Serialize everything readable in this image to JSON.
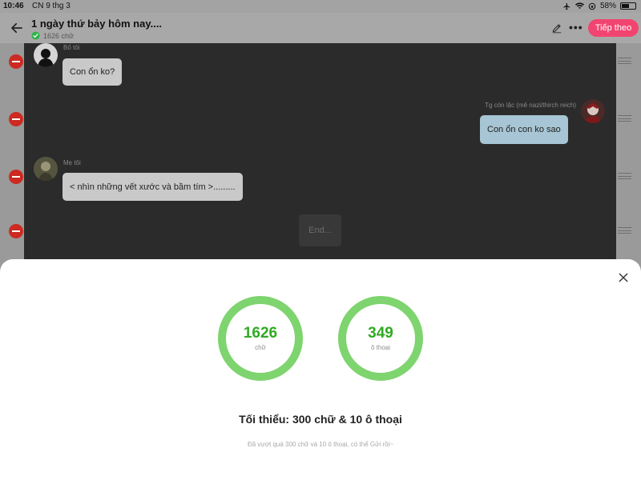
{
  "status_bar": {
    "time": "10:46",
    "date": "CN 9 thg 3",
    "battery_percent": "58%",
    "battery_level": 0.58
  },
  "header": {
    "title": "1 ngày thứ bảy hôm nay....",
    "word_count": "1626 chữ",
    "next_button": "Tiếp theo"
  },
  "chat": {
    "messages": [
      {
        "speaker": "Bố tôi",
        "text": "Con ổn ko?",
        "side": "left"
      },
      {
        "speaker": "Tg còn lặc (mê nazi/thirch reich)",
        "text": "Con ổn con ko sao",
        "side": "right"
      },
      {
        "speaker": "Mẹ tôi",
        "text": "< nhìn những vết xước và bầm tím >.........",
        "side": "left"
      }
    ],
    "end_label": "End..."
  },
  "sheet": {
    "words": {
      "value": "1626",
      "unit": "chữ"
    },
    "dialogues": {
      "value": "349",
      "unit": "ô thoại"
    },
    "minimum": "Tối thiểu: 300 chữ & 10 ô thoại",
    "note": "Đã vượt quá 300 chữ và 10 ô thoại, có thể Gửi rồi~"
  },
  "colors": {
    "accent_pink": "#f24470",
    "ring_green": "#7ed46e",
    "number_green": "#2faa22",
    "delete_red": "#cc2a22"
  }
}
